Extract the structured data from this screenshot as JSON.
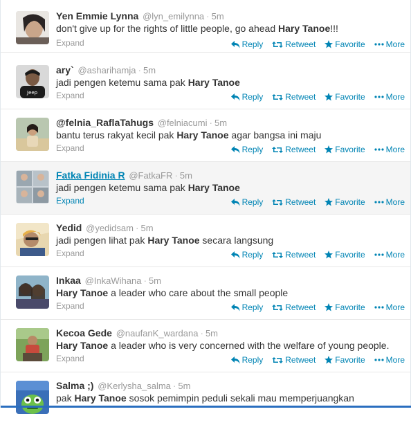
{
  "actions": {
    "reply": "Reply",
    "retweet": "Retweet",
    "favorite": "Favorite",
    "more": "More",
    "expand": "Expand"
  },
  "tweets": [
    {
      "fullname": "Yen Emmie Lynna",
      "username": "@lyn_emilynna",
      "time": "5m",
      "text_before": "don't give up for the rights of little people, go ahead ",
      "bold": "Hary Tanoe",
      "text_after": "!!!",
      "avatar_icon": "user-avatar-photo"
    },
    {
      "fullname": "ary`",
      "username": "@asharihamja",
      "time": "5m",
      "text_before": "jadi pengen ketemu sama pak ",
      "bold": "Hary Tanoe",
      "text_after": "",
      "avatar_icon": "user-avatar-photo"
    },
    {
      "fullname": "@felnia_RaflaTahugs",
      "username": "@felniacumi",
      "time": "5m",
      "text_before": "bantu terus rakyat kecil pak ",
      "bold": "Hary Tanoe",
      "text_after": " agar bangsa ini maju",
      "avatar_icon": "user-avatar-photo"
    },
    {
      "fullname": "Fatka Fidinia R",
      "username": "@FatkaFR",
      "time": "5m",
      "text_before": "jadi pengen ketemu sama pak ",
      "bold": "Hary Tanoe",
      "text_after": "",
      "avatar_icon": "user-avatar-photo"
    },
    {
      "fullname": "Yedid",
      "username": "@yedidsam",
      "time": "5m",
      "text_before": "jadi pengen lihat pak ",
      "bold": "Hary Tanoe",
      "text_after": " secara langsung",
      "avatar_icon": "user-avatar-photo"
    },
    {
      "fullname": "Inkaa",
      "username": "@InkaWihana",
      "time": "5m",
      "text_before": "",
      "bold": "Hary Tanoe",
      "text_after": " a leader who care about the small people",
      "avatar_icon": "user-avatar-photo"
    },
    {
      "fullname": "Kecoa Gede",
      "username": "@naufanK_wardana",
      "time": "5m",
      "text_before": "",
      "bold": "Hary Tanoe",
      "text_after": " a leader who is very concerned with the welfare of young people.",
      "avatar_icon": "user-avatar-photo"
    },
    {
      "fullname": "Salma ;)",
      "username": "@Kerlysha_salma",
      "time": "5m",
      "text_before": "pak ",
      "bold": "Hary Tanoe",
      "text_after": " sosok pemimpin peduli sekali mau memperjuangkan",
      "avatar_icon": "user-avatar-cartoon"
    }
  ]
}
